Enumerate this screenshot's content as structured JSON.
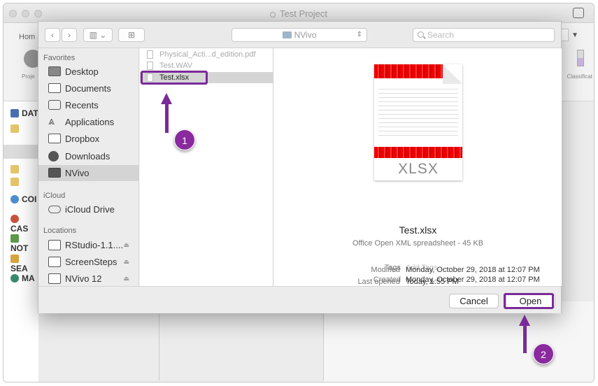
{
  "background_window": {
    "title": "Test Project",
    "toolbar_home": "Hom",
    "toolbar_project": "Proje",
    "toolbar_classification": "Classificat",
    "sidebar_items": [
      "DAT",
      "COI",
      "CAS",
      "NOT",
      "SEA",
      "MA"
    ]
  },
  "dialog": {
    "toolbar": {
      "view_button": "▥ ⌄",
      "path_popup": "NVivo",
      "search_placeholder": "Search"
    },
    "sidebar": {
      "sections": [
        {
          "title": "Favorites"
        },
        {
          "title": "iCloud"
        },
        {
          "title": "Locations"
        }
      ],
      "favorites": [
        "Desktop",
        "Documents",
        "Recents",
        "Applications",
        "Dropbox",
        "Downloads",
        "NVivo"
      ],
      "selected": "NVivo",
      "icloud": [
        "iCloud Drive"
      ],
      "locations": [
        "RStudio-1.1....",
        "ScreenSteps",
        "NVivo 12"
      ],
      "eject_icon": "⏏"
    },
    "files": [
      {
        "name": "Physical_Acti...d_edition.pdf",
        "selected": false
      },
      {
        "name": "Test.WAV",
        "selected": false
      },
      {
        "name": "Test.xlsx",
        "selected": true
      }
    ],
    "preview": {
      "thumbnail_label": "XLSX",
      "filename": "Test.xlsx",
      "kind": "Office Open XML spreadsheet - 45 KB",
      "meta": [
        {
          "label": "Tags",
          "value": "Add Tags..."
        },
        {
          "label": "Created",
          "value": "Monday, October 29, 2018 at 12:07 PM"
        },
        {
          "label": "Modified",
          "value": "Monday, October 29, 2018 at 12:07 PM"
        },
        {
          "label": "Last opened",
          "value": "Today, 1:55 PM"
        }
      ]
    },
    "buttons": {
      "cancel": "Cancel",
      "open": "Open"
    }
  },
  "annotations": {
    "step1": "1",
    "step2": "2",
    "color": "#7b2a99"
  }
}
